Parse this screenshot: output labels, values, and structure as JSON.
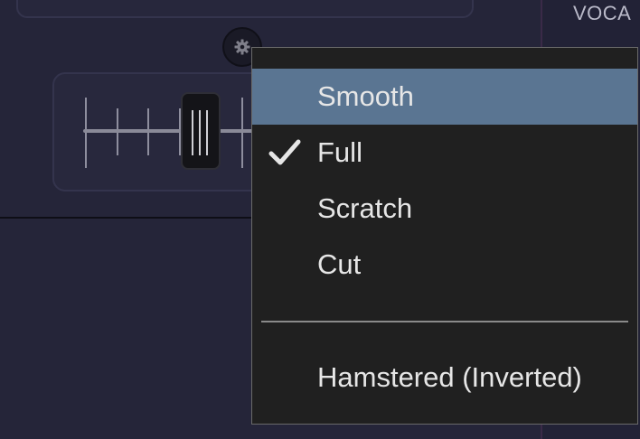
{
  "background_panel": {
    "vocal_label": "VOCA"
  },
  "settings_button": {
    "icon": "gear-icon"
  },
  "crossfader": {
    "knob_position": 0.63
  },
  "context_menu": {
    "items": [
      {
        "label": "Smooth",
        "highlighted": true,
        "checked": false
      },
      {
        "label": "Full",
        "highlighted": false,
        "checked": true
      },
      {
        "label": "Scratch",
        "highlighted": false,
        "checked": false
      },
      {
        "label": "Cut",
        "highlighted": false,
        "checked": false
      }
    ],
    "extra_items": [
      {
        "label": "Hamstered (Inverted)",
        "checked": false
      }
    ]
  },
  "colors": {
    "highlight": "#5a7592",
    "menu_bg": "#202020",
    "text": "#e6e6e6"
  }
}
